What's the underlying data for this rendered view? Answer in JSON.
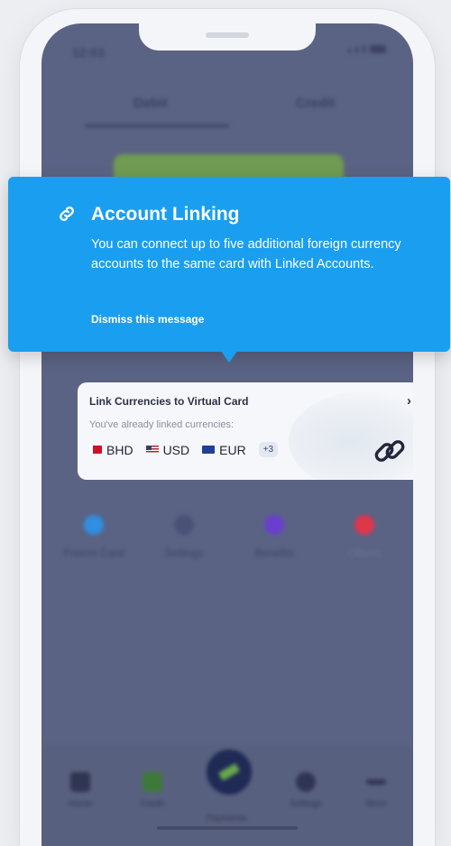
{
  "status_bar": {
    "time": "12:03"
  },
  "top_tabs": {
    "debit": "Debit",
    "credit": "Credit"
  },
  "tooltip": {
    "title": "Account Linking",
    "body": "You can connect up to five additional foreign currency accounts to the same card with Linked Accounts.",
    "dismiss": "Dismiss this message",
    "icon": "link-icon",
    "background": "#1a9ef0"
  },
  "link_card": {
    "title": "Link Currencies to Virtual Card",
    "subtitle": "You've already linked currencies:",
    "currencies": [
      {
        "code": "BHD",
        "flag": "bahrain-flag"
      },
      {
        "code": "USD",
        "flag": "us-flag"
      },
      {
        "code": "EUR",
        "flag": "eu-flag"
      }
    ],
    "more_badge": "+3",
    "icon": "chain-link-icon"
  },
  "actions": [
    {
      "label": "Freeze Card",
      "color": "#2f8fe0"
    },
    {
      "label": "Settings",
      "color": "#4a5275"
    },
    {
      "label": "Benefits",
      "color": "#6a3fd0"
    },
    {
      "label": "Others",
      "color": "#e0364a"
    }
  ],
  "bottom_nav": [
    {
      "label": "Home"
    },
    {
      "label": "Cards"
    },
    {
      "label": "Payments"
    },
    {
      "label": "Settings"
    },
    {
      "label": "More"
    }
  ],
  "colors": {
    "overlay": "#5b6384",
    "card_green": "#6f9b52"
  }
}
